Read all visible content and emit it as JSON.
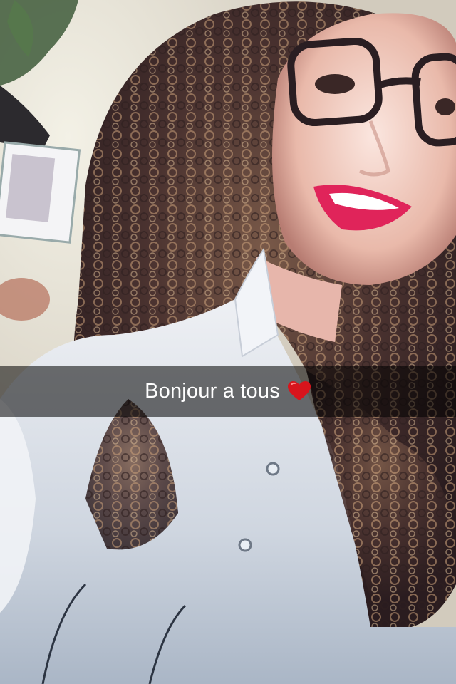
{
  "snap": {
    "caption_text": "Bonjour a tous",
    "caption_emoji": "red-heart-icon"
  },
  "colors": {
    "caption_bar": "#000000",
    "caption_text": "#ffffff",
    "heart": "#d8141c"
  }
}
